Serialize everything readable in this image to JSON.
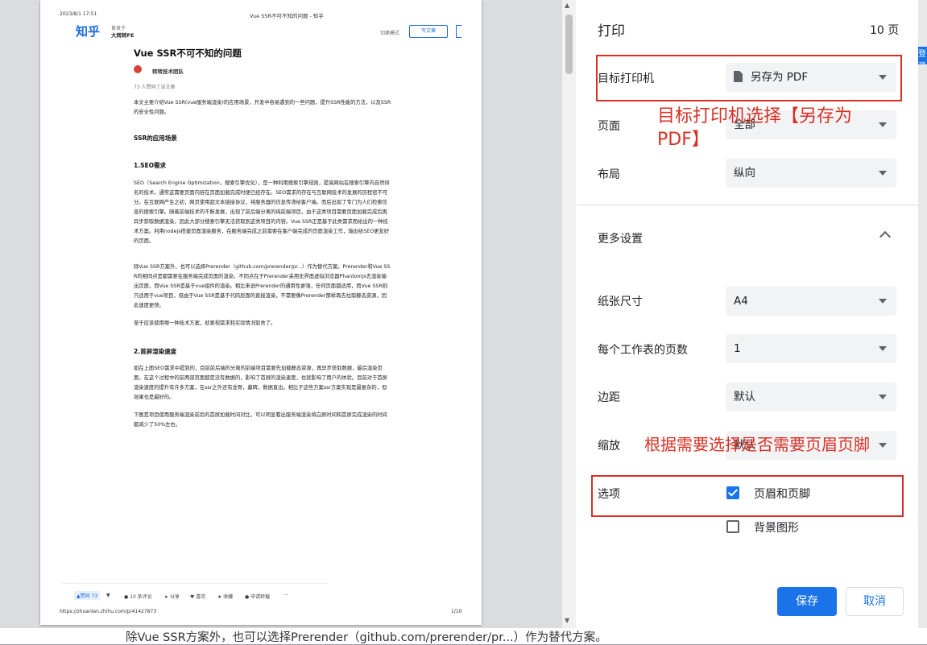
{
  "preview": {
    "header_date": "2023/8/1 17:51",
    "header_title": "Vue SSR不可不知的问题 - 知乎",
    "logo": "知乎",
    "column_prefix": "首发于",
    "column_name": "大转转FE",
    "switch_mode": "切换模式",
    "write_article": "写文章",
    "article_title": "Vue SSR不可不知的问题",
    "author": "转转技术团队",
    "liked_count": "73 人赞同了该文章",
    "intro": "本文主要介绍Vue SSR(vue服务端渲染)的应用场景，开发中容易遇到的一些问题，提升SSR性能的方法，以及SSR的安全性问题。",
    "h_scene": "SSR的应用场景",
    "h_seo": "1.SEO需求",
    "p_seo": "SEO（Search Engine Optimization，搜索引擎优化），是一种利用搜索引擎规则，提高网站在搜索引擎内自然排名的技术。通常这需要页面内容在页面加载完成时便已经存在。SEO需求的存在与互联网技术的发展的历程密不可分。在互联网产生之初，网页使用超文本链接协议，将服务器的信息传递给客户端。而后出现了专门为人们检索信息的搜索引擎。随着前端技术的不断发展，出现了前后端分离的纯前端项目，由于这类项目需要页面加载完成后再异步获取数据渲染，因此大部分搜索引擎无法获取到这类项目的内容。Vue SSR正是基于此类需求而给出的一种技术方案。利用nodejs搭建页面渲染服务，在服务端完成之前需要在客户端完成的页面渲染工作，输出给SEO更友好的页面。",
    "p_prerender": "除Vue SSR方案外，也可以选择Prerender（github.com/prerender/pr...）作为替代方案。Prerender和Vue SSR的相同点是都需要在服务端完成页面的渲染，不同点在于Prerender采用无界面虚拟浏览器Phantomjs去渲染输出页面，而Vue SSR是基于vue组件的渲染。相比来说Prerender的通用性更强，任何页面都适用，而Vue SSR则只适用于vue项目，但由于Vue SSR是基于代码层面的直接渲染，不需要像Prerender那样再去拉取静态资源，因此速度更快。",
    "p_choose": "至于应该使用哪一种技术方案，就要视需求和实际情况取舍了。",
    "h_first": "2.首屏渲染速度",
    "p_first": "如在上面SEO需求中提到的，目前前后端的分离的前端项目需要先加载静态资源，再异步获取数据，最后渲染页面，在这个过程中的前两部页面都是没有数据的，影响了首屏的渲染速度，也就影响了用户的体验。目前对于首屏渲染速度的提升有许多方案，在ssr之外还有龙骨，墓碑，数据直出。相比于这些方案ssr方案实现是最复杂的，但效果也是最好的。",
    "p_chart": "下图是项目使用服务端渲染前后的首屏加载时间对比，可以明显看出服务端渲染将白屏时间和首屏完成渲染的时间都减少了50%左右。",
    "footer_vote": "▲赞同 73",
    "footer_down": "▼",
    "footer_comments": "10 条评论",
    "footer_share": "分享",
    "footer_like": "喜欢",
    "footer_fav": "收藏",
    "footer_apply": "申请转载",
    "footer_more": "···",
    "url": "https://zhuanlan.zhihu.com/p/41427873",
    "page_no": "1/10"
  },
  "panel": {
    "title": "打印",
    "page_count": "10 页",
    "printer_label": "目标打印机",
    "printer_value": "另存为 PDF",
    "pages_label": "页面",
    "pages_value": "全部",
    "layout_label": "布局",
    "layout_value": "纵向",
    "more_settings": "更多设置",
    "paper_label": "纸张尺寸",
    "paper_value": "A4",
    "per_sheet_label": "每个工作表的页数",
    "per_sheet_value": "1",
    "margin_label": "边距",
    "margin_value": "默认",
    "scale_label": "缩放",
    "scale_value": "默认",
    "options_label": "选项",
    "opt_header_footer": "页眉和页脚",
    "opt_header_footer_checked": true,
    "opt_background": "背景图形",
    "opt_background_checked": false,
    "save_button": "保存",
    "cancel_button": "取消"
  },
  "annotations": {
    "anno_printer": "目标打印机选择【另存为PDF】",
    "anno_header": "根据需要选择是否需要页眉页脚",
    "color": "#d93025"
  },
  "edge_tab": "登录",
  "bottom_text": "除Vue SSR方案外，也可以选择Prerender（github.com/prerender/pr...）作为替代方案。",
  "accent_color": "#1a73e8"
}
